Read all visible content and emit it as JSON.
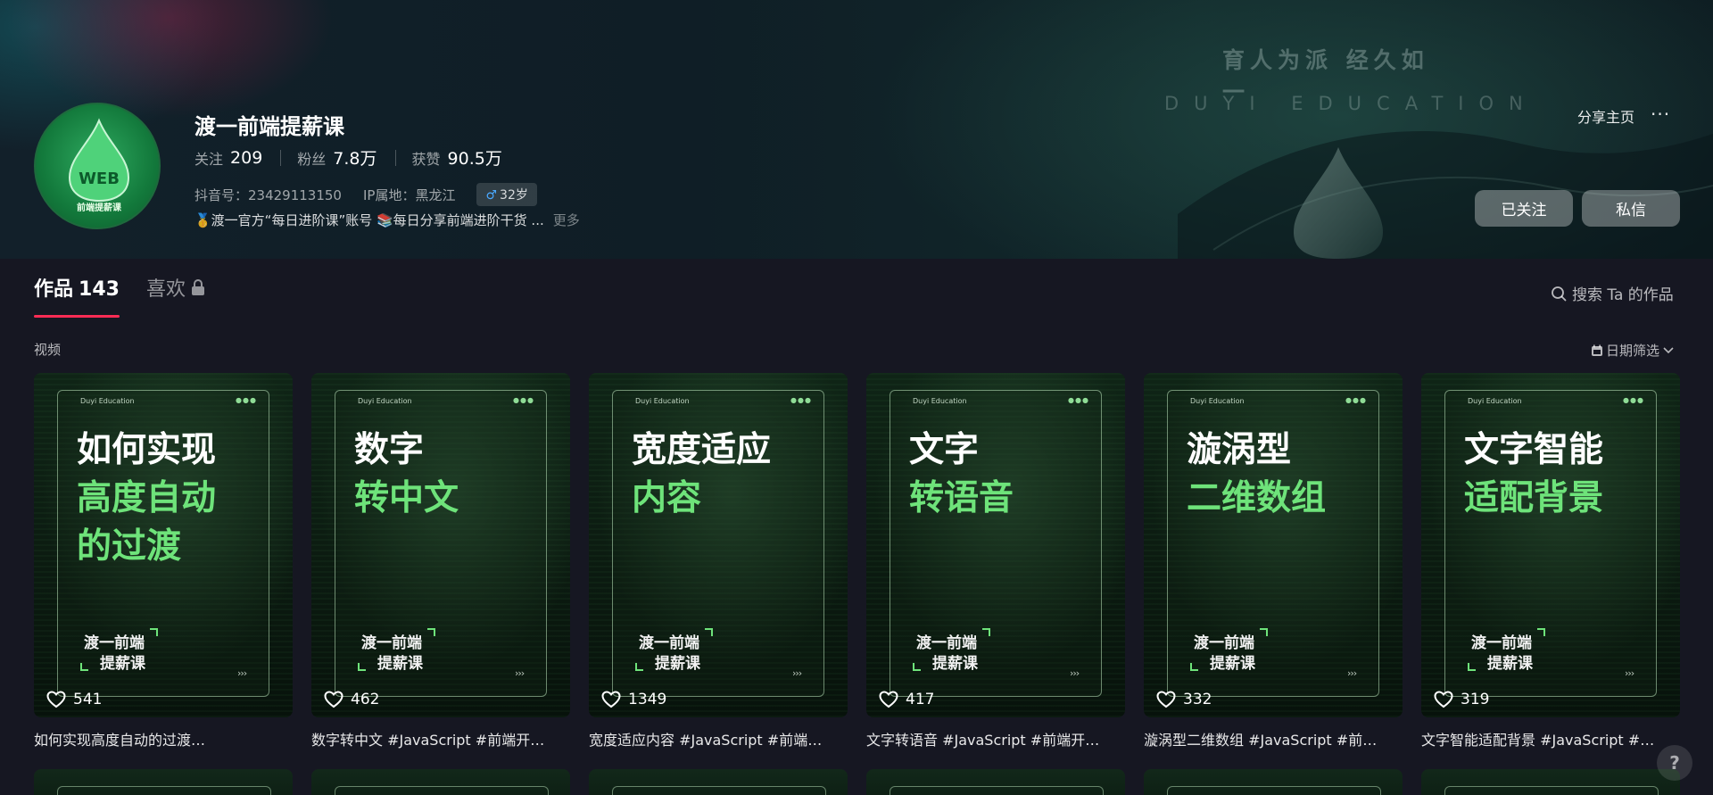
{
  "profile": {
    "name": "渡一前端提薪课",
    "avatar_caption": "前端提薪课",
    "stats": [
      {
        "label": "关注",
        "value": "209"
      },
      {
        "label": "粉丝",
        "value": "7.8万"
      },
      {
        "label": "获赞",
        "value": "90.5万"
      }
    ],
    "douyin_id": "抖音号：23429113150",
    "ip_location": "IP属地：黑龙江",
    "age_tag": "32岁",
    "gender_symbol": "♂",
    "bio": "🥇渡一官方“每日进阶课”账号 📚每日分享前端进阶干货 ...",
    "bio_more": "更多"
  },
  "banner": {
    "slogan": "育人为派  经久如一",
    "subtitle": "DUYI EDUCATION"
  },
  "actions": {
    "share": "分享主页",
    "more": "···",
    "follow": "已关注",
    "message": "私信"
  },
  "tabs": {
    "works_label": "作品",
    "works_count": "143",
    "likes_label": "喜欢"
  },
  "search": {
    "placeholder": "搜索 Ta 的作品"
  },
  "section": {
    "label": "视频",
    "date_filter": "日期筛选"
  },
  "cover_common": {
    "brand": "Duyi Education",
    "dots": "●●●",
    "logo_line1": "渡一前端",
    "logo_line2": "提薪课",
    "arrows": "›››"
  },
  "videos": [
    {
      "title_white": "如何实现",
      "title_green": "高度自动\n的过渡",
      "likes": "541",
      "caption": "如何实现高度自动的过渡…"
    },
    {
      "title_white": "数字",
      "title_green": "转中文",
      "likes": "462",
      "caption": "数字转中文 #JavaScript #前端开…"
    },
    {
      "title_white": "宽度适应",
      "title_green": "内容",
      "likes": "1349",
      "caption": "宽度适应内容 #JavaScript #前端…"
    },
    {
      "title_white": "文字",
      "title_green": "转语音",
      "likes": "417",
      "caption": "文字转语音 #JavaScript #前端开…"
    },
    {
      "title_white": "漩涡型",
      "title_green": "二维数组",
      "likes": "332",
      "caption": "漩涡型二维数组 #JavaScript #前…"
    },
    {
      "title_white": "文字智能",
      "title_green": "适配背景",
      "likes": "319",
      "caption": "文字智能适配背景 #JavaScript #…"
    }
  ],
  "help": "?",
  "colors": {
    "accent": "#fe2c55",
    "cover_green": "#6ee37a",
    "background": "#161722"
  }
}
